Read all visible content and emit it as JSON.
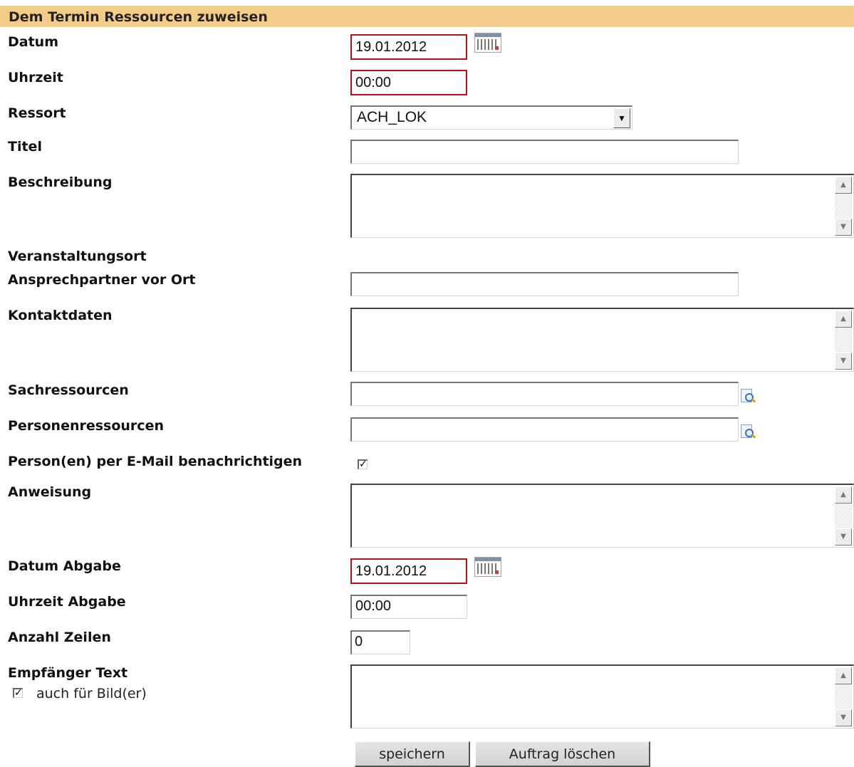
{
  "form": {
    "title": "Dem Termin Ressourcen zuweisen",
    "labels": {
      "datum": "Datum",
      "uhrzeit": "Uhrzeit",
      "ressort": "Ressort",
      "titel": "Titel",
      "beschreibung": "Beschreibung",
      "veranstaltungsort": "Veranstaltungsort",
      "ansprechpartner": "Ansprechpartner vor Ort",
      "kontaktdaten": "Kontaktdaten",
      "sachressourcen": "Sachressourcen",
      "personenressourcen": "Personenressourcen",
      "email_benachrichtigen": "Person(en) per E-Mail benachrichtigen",
      "anweisung": "Anweisung",
      "datum_abgabe": "Datum Abgabe",
      "uhrzeit_abgabe": "Uhrzeit Abgabe",
      "anzahl_zeilen": "Anzahl Zeilen",
      "empfaenger_text": "Empfänger Text",
      "auch_fuer_bilder": "auch für Bild(er)"
    },
    "values": {
      "datum": "19.01.2012",
      "uhrzeit": "00:00",
      "ressort": "ACH_LOK",
      "titel": "",
      "ansprechpartner": "",
      "sachressourcen": "",
      "personenressourcen": "",
      "email_benachrichtigen": true,
      "datum_abgabe": "19.01.2012",
      "uhrzeit_abgabe": "00:00",
      "anzahl_zeilen": "0",
      "auch_fuer_bilder": true
    },
    "buttons": {
      "speichern": "speichern",
      "auftrag_loeschen": "Auftrag löschen"
    },
    "icons": {
      "calendar": "calendar-icon",
      "lookup": "lookup-icon",
      "dropdown": "chevron-down-icon",
      "scroll_up": "scroll-up-arrow",
      "scroll_down": "scroll-down-arrow",
      "check": "✓"
    }
  },
  "colors": {
    "header_bg": "#f3cd88",
    "required_border": "#b3121a",
    "button_bg": "#d8d8d8"
  }
}
